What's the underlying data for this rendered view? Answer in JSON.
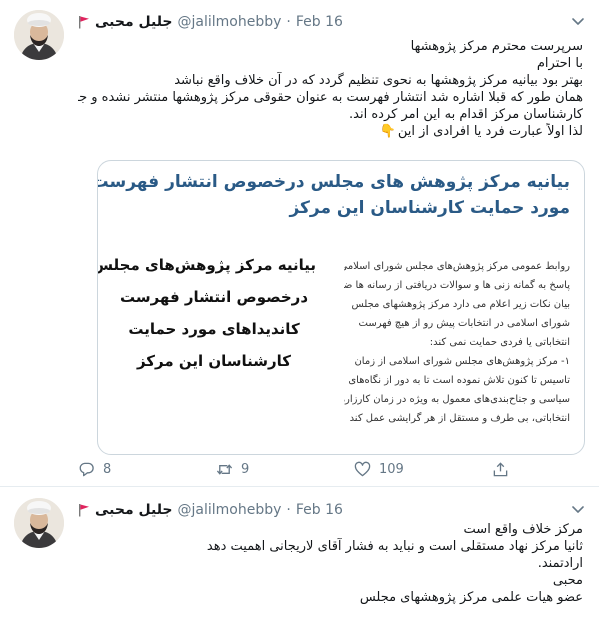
{
  "colors": {
    "accent": "#1da1f2",
    "text": "#14171a",
    "muted": "#657786",
    "card_title": "#2a5a86",
    "flag": "#e0245e"
  },
  "tweets": [
    {
      "author": {
        "name": "جلیل محبی",
        "handle": "@jalilmohebby",
        "date": "Feb 16"
      },
      "lines": [
        "سرپرست محترم مرکز پژوهشها",
        "با احترام",
        "بهتر بود بیانیه مرکز پژوهشها به نحوی تنظیم گردد که در آن خلاف واقع نباشد",
        "همان طور که قبلا اشاره شد انتشار فهرست به عنوان حقوقی مرکز پژوهشها منتشر نشده و جمعی از",
        "کارشناسان مرکز اقدام به این امر کرده اند.",
        "لذا اولاً عبارت فرد یا افرادی از این"
      ],
      "emoji": "👇",
      "card": {
        "title_lines": [
          "بیانیه مرکز پژوهش های مجلس درخصوص انتشار فهرست کاندیداهای",
          "مورد حمایت کارشناسان این مرکز"
        ],
        "headline_lines": [
          "بیانیه مرکز پژوهش‌های مجلس",
          "درخصوص انتشار فهرست",
          "کاندیداهای مورد حمایت",
          "کارشناسان این مرکز"
        ],
        "text_lines": [
          "روابط عمومی مرکز پژوهش‌های مجلس شورای اسلامی، در",
          "پاسخ به گمانه زنی ها و سوالات دریافتی از رسانه ها ضمن",
          "بیان نکات زیر اعلام می دارد مرکز پژوهشهای مجلس",
          "شورای اسلامی در انتخابات پیش رو از هیچ فهرست",
          "انتخاباتی یا فردی حمایت نمی کند:",
          "۱- مرکز پژوهش‌های مجلس شورای اسلامی از زمان",
          "تاسیس تا کنون تلاش نموده است تا به دور از نگاه‌های",
          "سیاسی و جناح‌بندی‌های معمول به ویژه در زمان کارزارهای",
          "انتخاباتی، بی طرف و مستقل از هر گرایشی عمل کند"
        ]
      },
      "actions": {
        "replies": "8",
        "retweets": "9",
        "likes": "109"
      }
    },
    {
      "author": {
        "name": "جلیل محبی",
        "handle": "@jalilmohebby",
        "date": "Feb 16"
      },
      "lines": [
        "مرکز خلاف واقع است",
        "ثانیا مرکز نهاد مستقلی است و نباید به فشار آقای لاریجانی اهمیت دهد",
        "ارادتمند.",
        "محبی",
        "عضو هیات علمی مرکز پژوهشهای مجلس"
      ]
    }
  ]
}
